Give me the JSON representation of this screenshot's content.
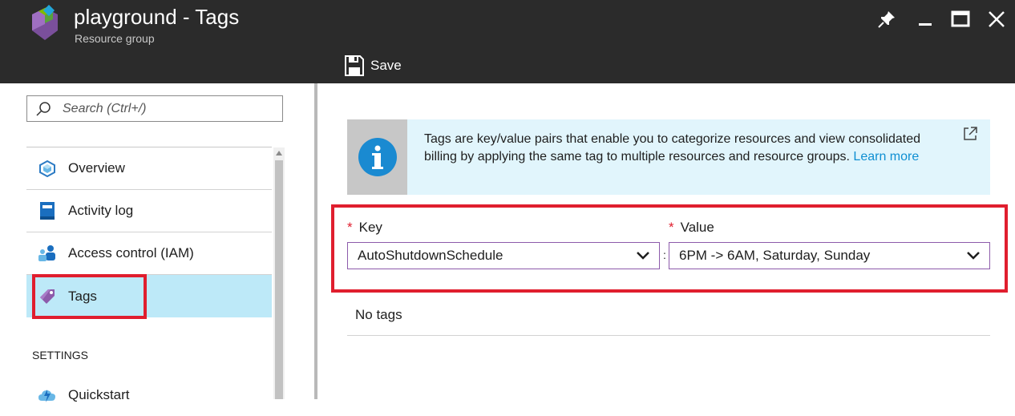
{
  "header": {
    "title": "playground - Tags",
    "subtitle": "Resource group",
    "save_label": "Save",
    "background": "#2b2b2b"
  },
  "sidebar": {
    "search_placeholder": "Search (Ctrl+/)",
    "items": [
      {
        "label": "Overview",
        "icon": "overview-cube-icon"
      },
      {
        "label": "Activity log",
        "icon": "activity-log-icon"
      },
      {
        "label": "Access control (IAM)",
        "icon": "users-icon"
      },
      {
        "label": "Tags",
        "icon": "tag-icon",
        "active": true
      },
      {
        "label": "Quickstart",
        "icon": "quickstart-cloud-icon"
      }
    ],
    "section_label": "SETTINGS",
    "active_color": "#bde9f8"
  },
  "info": {
    "text": "Tags are key/value pairs that enable you to categorize resources and view consolidated billing by applying the same tag to multiple resources and resource groups.",
    "link": "Learn more"
  },
  "form": {
    "required_mark": "*",
    "key_label": "Key",
    "value_label": "Value",
    "key_value": "AutoShutdownSchedule",
    "value_value": "6PM -> 6AM, Saturday, Sunday",
    "separator": ":"
  },
  "tags_list": {
    "empty_text": "No tags"
  },
  "colors": {
    "highlight_red": "#e01e2e",
    "link_blue": "#0f8fd2",
    "dropdown_border": "#8d5bab",
    "info_bg": "#e1f5fc"
  }
}
